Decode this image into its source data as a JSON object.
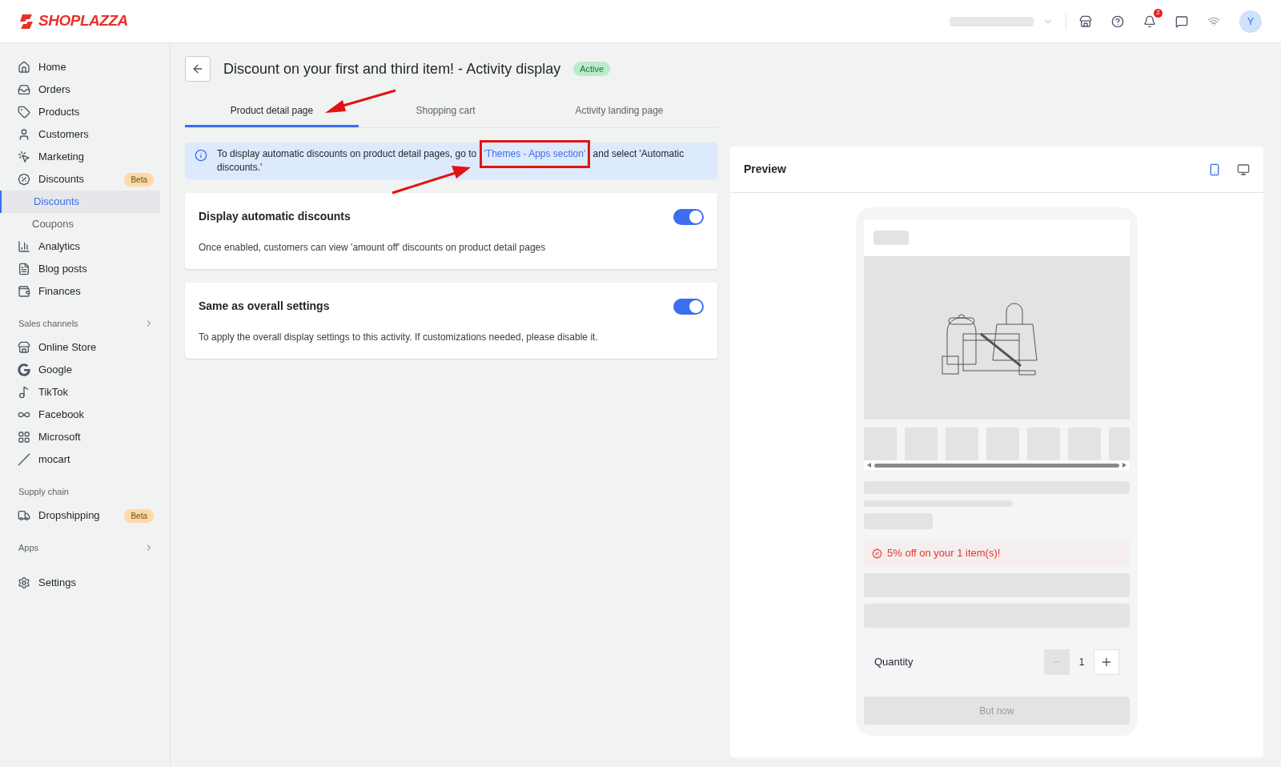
{
  "header": {
    "logo": "SHOPLAZZA",
    "notification_count": "2",
    "avatar": "Y"
  },
  "sidebar": {
    "groups": [
      {
        "items": [
          {
            "label": "Home"
          },
          {
            "label": "Orders"
          },
          {
            "label": "Products"
          },
          {
            "label": "Customers"
          },
          {
            "label": "Marketing"
          },
          {
            "label": "Discounts",
            "badge": "Beta",
            "children": [
              {
                "label": "Discounts",
                "selected": true
              },
              {
                "label": "Coupons",
                "selected": false
              }
            ]
          },
          {
            "label": "Analytics"
          },
          {
            "label": "Blog posts"
          },
          {
            "label": "Finances"
          }
        ]
      },
      {
        "title": "Sales channels",
        "expandable": true,
        "items": [
          {
            "label": "Online Store"
          },
          {
            "label": "Google"
          },
          {
            "label": "TikTok"
          },
          {
            "label": "Facebook"
          },
          {
            "label": "Microsoft"
          },
          {
            "label": "mocart"
          }
        ]
      },
      {
        "title": "Supply chain",
        "items": [
          {
            "label": "Dropshipping",
            "badge": "Beta"
          }
        ]
      },
      {
        "title": "Apps",
        "expandable": true
      },
      {
        "items": [
          {
            "label": "Settings"
          }
        ]
      }
    ]
  },
  "page": {
    "title": "Discount on your first and third item! - Activity display",
    "status": "Active",
    "tabs": [
      {
        "label": "Product detail page",
        "selected": true
      },
      {
        "label": "Shopping cart",
        "selected": false
      },
      {
        "label": "Activity landing page",
        "selected": false
      }
    ],
    "notice": {
      "before": "To display automatic discounts on product detail pages, go to",
      "link": "'Themes - Apps section'",
      "after": "and select 'Automatic discounts.'"
    },
    "settings": [
      {
        "title": "Display automatic discounts",
        "description": "Once enabled, customers can view 'amount off' discounts on product detail pages",
        "on": true
      },
      {
        "title": "Same as overall settings",
        "description": "To apply the overall display settings to this activity. If customizations needed, please disable it.",
        "on": true
      }
    ]
  },
  "preview": {
    "title": "Preview",
    "devices": [
      {
        "kind": "mobile",
        "selected": true
      },
      {
        "kind": "desktop",
        "selected": false
      }
    ],
    "discount_message": "5% off on your 1 item(s)!",
    "quantity_label": "Quantity",
    "quantity": "1",
    "buy_button": "But now"
  }
}
